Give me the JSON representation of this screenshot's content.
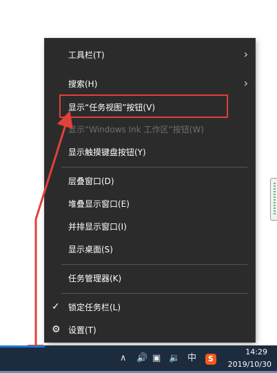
{
  "menu": {
    "items": [
      {
        "label": "工具栏(T)",
        "submenu": true
      },
      {
        "label": "搜索(H)",
        "submenu": true
      },
      {
        "label": "显示“任务视图”按钮(V)"
      },
      {
        "label": "显示“Windows Ink 工作区”按钮(W)",
        "disabled": true
      },
      {
        "label": "显示触摸键盘按钮(Y)"
      },
      {
        "label": "层叠窗口(D)"
      },
      {
        "label": "堆叠显示窗口(E)"
      },
      {
        "label": "并排显示窗口(I)"
      },
      {
        "label": "显示桌面(S)"
      },
      {
        "label": "任务管理器(K)"
      },
      {
        "label": "锁定任务栏(L)",
        "checked": true
      },
      {
        "label": "设置(T)",
        "icon": "gear-icon"
      }
    ]
  },
  "annotation": {
    "color": "#e0413b"
  },
  "taskbar": {
    "clock_time": "14:29",
    "clock_date": "2019/10/30",
    "ime_label": "中",
    "sogou_label": "S"
  },
  "colors": {
    "menu_bg": "#2b2b2b",
    "taskbar_bg": "#1d2b3f",
    "highlight": "#e0413b"
  }
}
